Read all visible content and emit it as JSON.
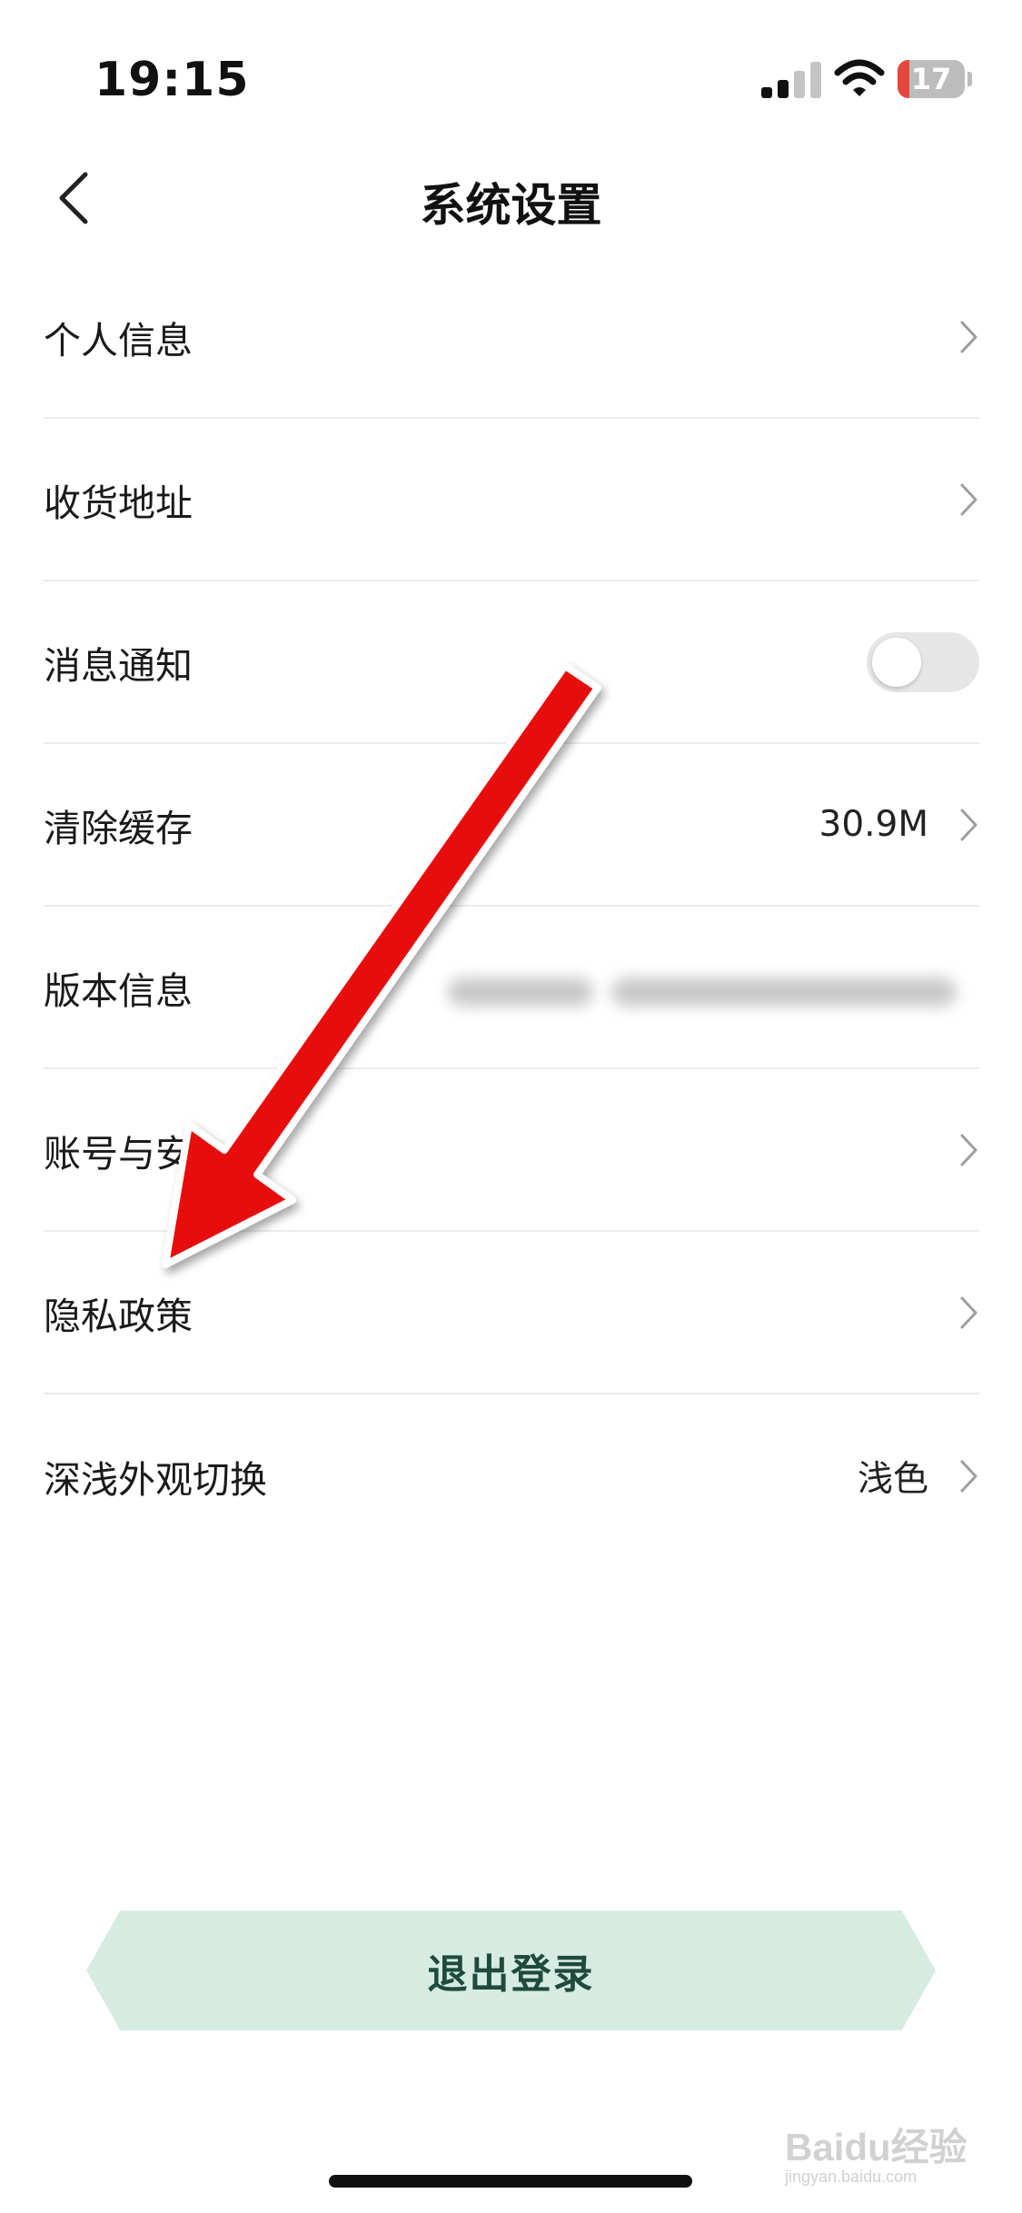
{
  "status_bar": {
    "time": "19:15",
    "battery_level": "17",
    "battery_fraction": 0.17,
    "colors": {
      "battery_low": "#e8453c"
    }
  },
  "header": {
    "title": "系统设置",
    "back_icon": "chevron-left-icon"
  },
  "settings": {
    "personal_info": {
      "label": "个人信息"
    },
    "shipping_address": {
      "label": "收货地址"
    },
    "notifications": {
      "label": "消息通知",
      "enabled": false
    },
    "clear_cache": {
      "label": "清除缓存",
      "value": "30.9M"
    },
    "version_info": {
      "label": "版本信息"
    },
    "account_security": {
      "label": "账号与安"
    },
    "privacy_policy": {
      "label": "隐私政策"
    },
    "appearance": {
      "label": "深浅外观切换",
      "value": "浅色"
    }
  },
  "logout": {
    "label": "退出登录",
    "colors": {
      "background": "#d6ece3",
      "text": "#1f4a3d"
    }
  },
  "annotation": {
    "arrow_color": "#e8100f"
  },
  "watermark": {
    "brand": "Baidu经验",
    "domain": "jingyan.baidu.com"
  }
}
